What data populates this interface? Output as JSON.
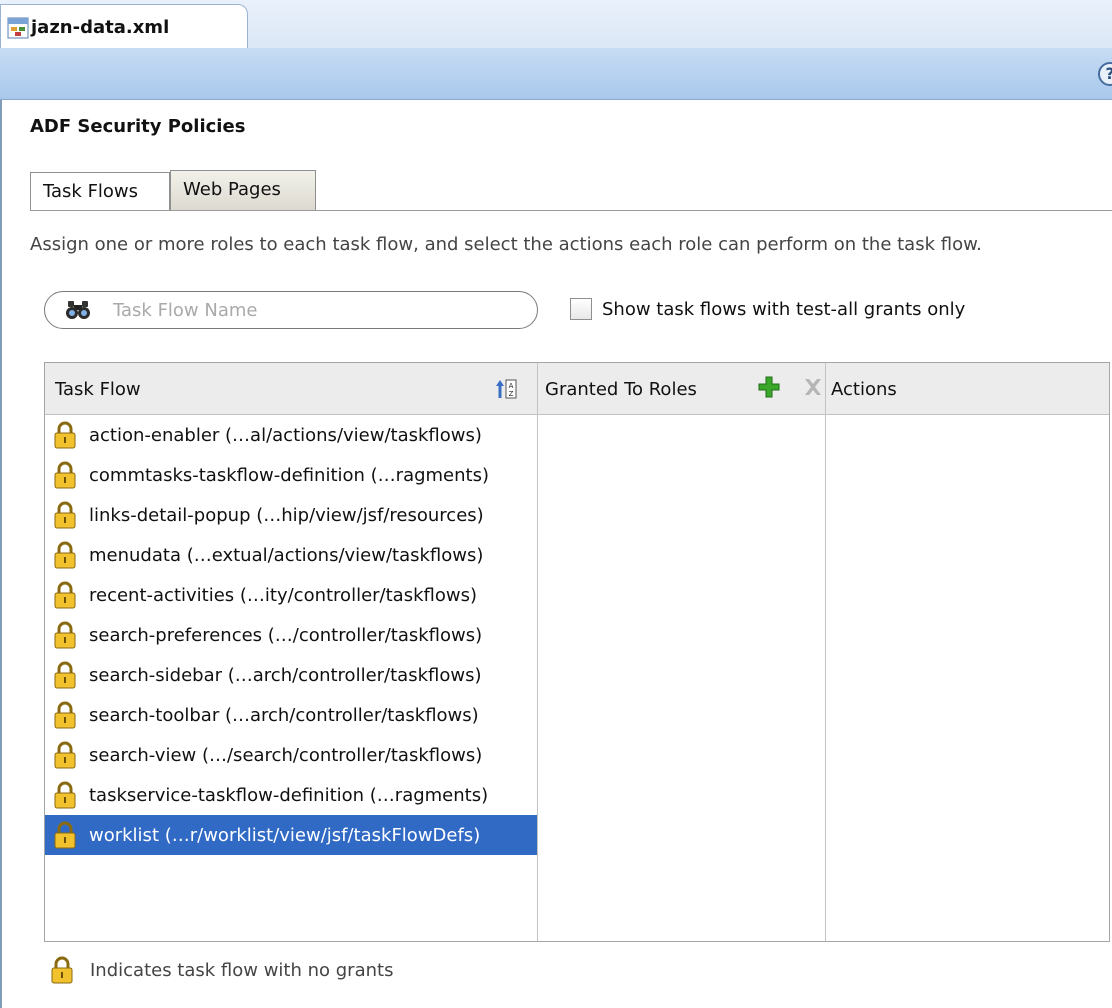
{
  "editor": {
    "file_tab": "jazn-data.xml"
  },
  "page": {
    "title": "ADF Security Policies"
  },
  "tabs": [
    {
      "label": "Task Flows",
      "selected": true
    },
    {
      "label": "Web Pages",
      "selected": false
    }
  ],
  "instructions": "Assign one or more roles to each task flow, and select the actions each role can perform on the task flow.",
  "search": {
    "placeholder": "Task Flow Name",
    "value": ""
  },
  "filter": {
    "label": "Show task flows with test-all grants only",
    "checked": false
  },
  "table": {
    "columns": {
      "task_flow": "Task Flow",
      "granted_to_roles": "Granted To Roles",
      "actions": "Actions"
    },
    "rows": [
      {
        "label": "action-enabler (…al/actions/view/taskflows)",
        "selected": false
      },
      {
        "label": "commtasks-taskflow-definition (…ragments)",
        "selected": false
      },
      {
        "label": "links-detail-popup (…hip/view/jsf/resources)",
        "selected": false
      },
      {
        "label": "menudata (…extual/actions/view/taskflows)",
        "selected": false
      },
      {
        "label": "recent-activities (…ity/controller/taskflows)",
        "selected": false
      },
      {
        "label": "search-preferences (…/controller/taskflows)",
        "selected": false
      },
      {
        "label": "search-sidebar (…arch/controller/taskflows)",
        "selected": false
      },
      {
        "label": "search-toolbar (…arch/controller/taskflows)",
        "selected": false
      },
      {
        "label": "search-view (…/search/controller/taskflows)",
        "selected": false
      },
      {
        "label": "taskservice-taskflow-definition (…ragments)",
        "selected": false
      },
      {
        "label": "worklist (…r/worklist/view/jsf/taskFlowDefs)",
        "selected": true
      }
    ]
  },
  "legend": {
    "label": "Indicates task flow with no grants"
  },
  "icons": {
    "file": "xml-file-icon",
    "help": "help-icon",
    "search": "binoculars-icon",
    "sort": "sort-az-icon",
    "add": "add-plus-icon",
    "remove": "remove-x-icon",
    "lock": "lock-icon"
  },
  "colors": {
    "selection": "#316ac5",
    "add": "#3aa72a",
    "header_bar": "#b8d2f0"
  }
}
